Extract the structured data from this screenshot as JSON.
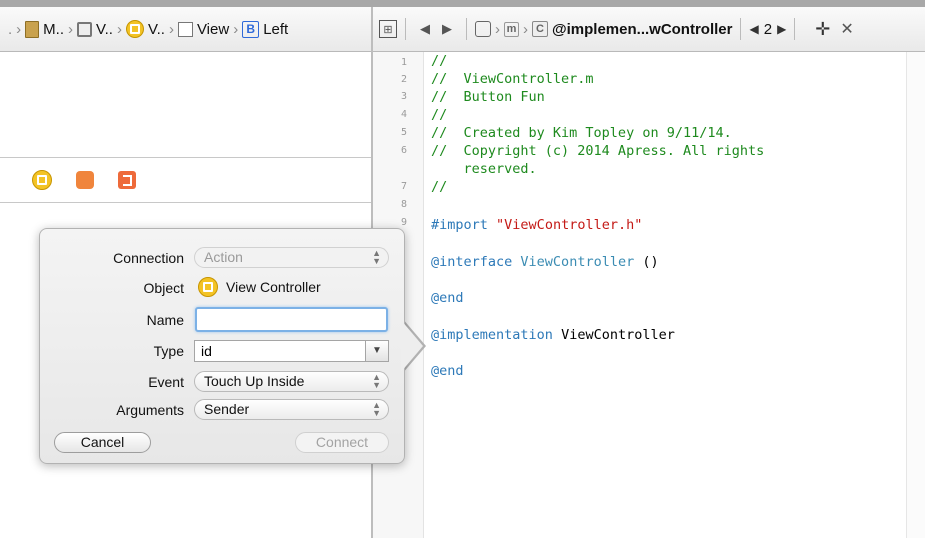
{
  "left_jumpbar": {
    "crumbs": [
      "M..",
      "V..",
      "V..",
      "View",
      "Left"
    ],
    "button_badge": "B",
    "back_glyph": "."
  },
  "right_jumpbar": {
    "m_badge": "m",
    "c_badge": "C",
    "file_label": "@implemen...wController",
    "counter": "2",
    "prev_glyph": "◀",
    "next_glyph": "▶",
    "back_glyph": "◀",
    "forward_glyph": "▶",
    "related_glyph": "⊞",
    "plus_glyph": "✛",
    "close_glyph": "✕"
  },
  "editor": {
    "line_numbers": [
      "1",
      "2",
      "3",
      "4",
      "5",
      "6",
      "7",
      "8",
      "9"
    ],
    "lines": [
      "//",
      "//  ViewController.m",
      "//  Button Fun",
      "//",
      "//  Created by Kim Topley on 9/11/14.",
      "//  Copyright (c) 2014 Apress. All rights",
      "    reserved.",
      "//",
      "#import",
      "\"ViewController.h\"",
      "@interface",
      "ViewController",
      "()",
      "@end",
      "@implementation",
      "ViewController",
      "@end"
    ]
  },
  "popover": {
    "connection_label": "Connection",
    "connection_value": "Action",
    "object_label": "Object",
    "object_value": "View Controller",
    "name_label": "Name",
    "name_value": "",
    "type_label": "Type",
    "type_value": "id",
    "event_label": "Event",
    "event_value": "Touch Up Inside",
    "arguments_label": "Arguments",
    "arguments_value": "Sender",
    "cancel_label": "Cancel",
    "connect_label": "Connect"
  },
  "colors": {
    "comment": "#1e8a1e",
    "keyword": "#2d79b8",
    "string": "#c41a16",
    "focus": "#7cb1e6"
  }
}
